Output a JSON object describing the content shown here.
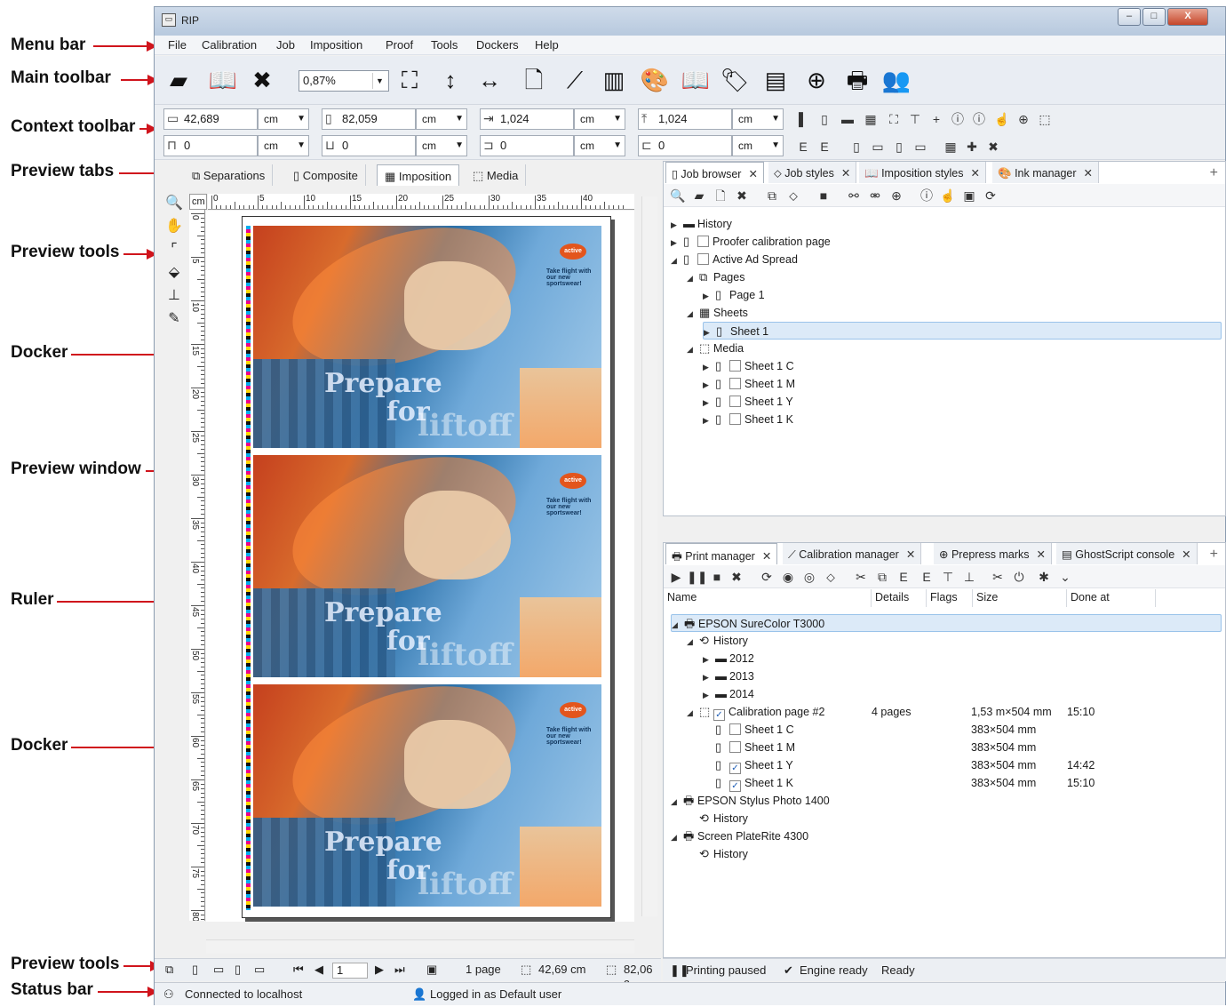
{
  "callouts": {
    "menu_bar": "Menu bar",
    "main_toolbar": "Main toolbar",
    "context_toolbar": "Context toolbar",
    "preview_tabs": "Preview tabs",
    "preview_tools_top": "Preview tools",
    "docker_top": "Docker",
    "preview_window": "Preview window",
    "ruler": "Ruler",
    "docker_bottom": "Docker",
    "preview_tools_bottom": "Preview tools",
    "status_bar": "Status bar"
  },
  "window": {
    "title": "RIP",
    "min_label": "–",
    "max_label": "□",
    "close_label": "X"
  },
  "menu": [
    "File",
    "Calibration",
    "Job",
    "Imposition",
    "Proof",
    "Tools",
    "Dockers",
    "Help"
  ],
  "main_toolbar": {
    "zoom_value": "0,87%",
    "icons": [
      "open-folder-icon",
      "book-icon",
      "book-close-icon",
      "fit-page-icon",
      "fit-height-icon",
      "fit-width-icon",
      "new-page-icon",
      "curve-icon",
      "ink-icon",
      "palette-icon",
      "open-book-icon",
      "tag-icon",
      "report-icon",
      "target-icon",
      "printer-icon",
      "users-icon"
    ]
  },
  "context_toolbar": {
    "row1": [
      {
        "value": "42,689",
        "unit": "cm"
      },
      {
        "value": "82,059",
        "unit": "cm"
      },
      {
        "value": "1,024",
        "unit": "cm"
      },
      {
        "value": "1,024",
        "unit": "cm"
      }
    ],
    "row2": [
      {
        "value": "0",
        "unit": "cm"
      },
      {
        "value": "0",
        "unit": "cm"
      },
      {
        "value": "0",
        "unit": "cm"
      },
      {
        "value": "0",
        "unit": "cm"
      }
    ]
  },
  "preview": {
    "tabs": [
      "Separations",
      "Composite",
      "Imposition",
      "Media"
    ],
    "active_tab": "Imposition",
    "ruler_unit": "cm",
    "top_ticks": [
      "0",
      "5",
      "10",
      "15",
      "20",
      "25",
      "30",
      "35",
      "40"
    ],
    "left_ticks": [
      "0",
      "5",
      "10",
      "15",
      "20",
      "25",
      "30",
      "35",
      "40",
      "45",
      "50",
      "55",
      "60",
      "65",
      "70",
      "75",
      "80"
    ],
    "ad": {
      "logo": "active",
      "headline": "Take flight with our new sportswear!",
      "line1": "Prepare",
      "line2": "for",
      "line3": "liftoff"
    }
  },
  "nav_bar": {
    "page_input": "1",
    "page_count": "1 page",
    "width": "42,69 cm",
    "height": "82,06 c"
  },
  "job_browser": {
    "tabs": [
      "Job browser",
      "Job styles",
      "Imposition styles",
      "Ink manager"
    ],
    "add": "+",
    "tree": [
      {
        "label": "History",
        "level": 0,
        "expander": "▶",
        "icon": "folder"
      },
      {
        "label": "Proofer calibration page",
        "level": 0,
        "expander": "▶",
        "icon": "page",
        "checkbox": true
      },
      {
        "label": "Active Ad Spread",
        "level": 0,
        "expander": "◢",
        "icon": "page",
        "checkbox": true
      },
      {
        "label": "Pages",
        "level": 1,
        "expander": "◢",
        "icon": "pages"
      },
      {
        "label": "Page 1",
        "level": 2,
        "expander": "▶",
        "icon": "page"
      },
      {
        "label": "Sheets",
        "level": 1,
        "expander": "◢",
        "icon": "sheets"
      },
      {
        "label": "Sheet 1",
        "level": 2,
        "expander": "▶",
        "icon": "page",
        "selected": true
      },
      {
        "label": "Media",
        "level": 1,
        "expander": "◢",
        "icon": "media"
      },
      {
        "label": "Sheet 1 C",
        "level": 2,
        "expander": "▶",
        "icon": "page",
        "checkbox": true
      },
      {
        "label": "Sheet 1 M",
        "level": 2,
        "expander": "▶",
        "icon": "page",
        "checkbox": true
      },
      {
        "label": "Sheet 1 Y",
        "level": 2,
        "expander": "▶",
        "icon": "page",
        "checkbox": true
      },
      {
        "label": "Sheet 1 K",
        "level": 2,
        "expander": "▶",
        "icon": "page",
        "checkbox": true
      }
    ]
  },
  "print_manager": {
    "tabs": [
      "Print manager",
      "Calibration manager",
      "Prepress marks",
      "GhostScript console"
    ],
    "add": "+",
    "columns": [
      "Name",
      "Details",
      "Flags",
      "Size",
      "Done at"
    ],
    "rows": [
      {
        "name": "EPSON SureColor T3000",
        "level": 0,
        "expander": "◢",
        "icon": "printer",
        "selected": true
      },
      {
        "name": "History",
        "level": 1,
        "expander": "◢",
        "icon": "history"
      },
      {
        "name": "2012",
        "level": 2,
        "expander": "▶",
        "icon": "folder"
      },
      {
        "name": "2013",
        "level": 2,
        "expander": "▶",
        "icon": "folder"
      },
      {
        "name": "2014",
        "level": 2,
        "expander": "▶",
        "icon": "folder"
      },
      {
        "name": "Calibration page #2",
        "level": 1,
        "expander": "◢",
        "icon": "media",
        "checkbox": "checked",
        "details": "4 pages",
        "size": "1,53 m×504 mm",
        "done": "15:10"
      },
      {
        "name": "Sheet 1 C",
        "level": 2,
        "expander": "",
        "icon": "page",
        "checkbox": "unchecked",
        "size": "383×504 mm",
        "done": ""
      },
      {
        "name": "Sheet 1 M",
        "level": 2,
        "expander": "",
        "icon": "page",
        "checkbox": "unchecked",
        "size": "383×504 mm",
        "done": ""
      },
      {
        "name": "Sheet 1 Y",
        "level": 2,
        "expander": "",
        "icon": "page",
        "checkbox": "checked",
        "size": "383×504 mm",
        "done": "14:42"
      },
      {
        "name": "Sheet 1 K",
        "level": 2,
        "expander": "",
        "icon": "page",
        "checkbox": "checked",
        "size": "383×504 mm",
        "done": "15:10"
      },
      {
        "name": "EPSON Stylus Photo 1400",
        "level": 0,
        "expander": "◢",
        "icon": "printer"
      },
      {
        "name": "History",
        "level": 1,
        "expander": "",
        "icon": "history"
      },
      {
        "name": "Screen PlateRite 4300",
        "level": 0,
        "expander": "◢",
        "icon": "printer"
      },
      {
        "name": "History",
        "level": 1,
        "expander": "",
        "icon": "history"
      }
    ]
  },
  "right_status": {
    "printing": "Printing paused",
    "engine": "Engine ready",
    "ready": "Ready"
  },
  "status_bar": {
    "connection": "Connected to localhost",
    "user": "Logged in as Default user"
  },
  "colors": {
    "callout_arrow": "#d0141c",
    "selection": "#dceaf8"
  }
}
